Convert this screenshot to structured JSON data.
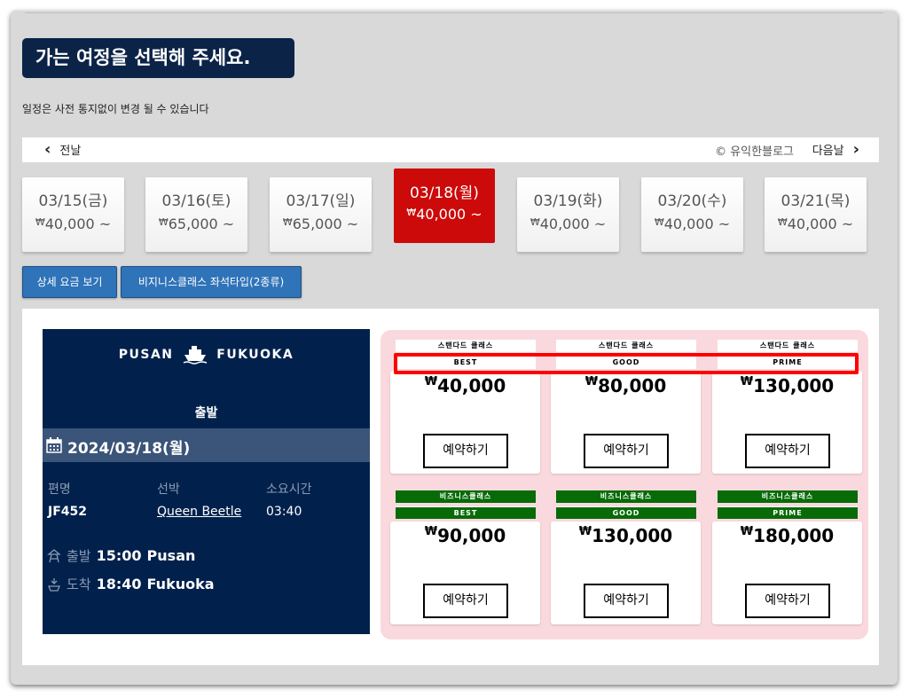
{
  "header": {
    "title": "가는 여정을 선택해 주세요.",
    "subtitle": "일정은 사전 통지없이 변경 될 수 있습니다"
  },
  "date_nav": {
    "prev_label": "전날",
    "next_label": "다음날",
    "watermark": "© 유익한블로그"
  },
  "currency_symbol": "₩",
  "days": [
    {
      "date": "03/15(금)",
      "price": "40,000 ~",
      "active": false
    },
    {
      "date": "03/16(토)",
      "price": "65,000 ~",
      "active": false
    },
    {
      "date": "03/17(일)",
      "price": "65,000 ~",
      "active": false
    },
    {
      "date": "03/18(월)",
      "price": "40,000 ~",
      "active": true
    },
    {
      "date": "03/19(화)",
      "price": "40,000 ~",
      "active": false
    },
    {
      "date": "03/20(수)",
      "price": "40,000 ~",
      "active": false
    },
    {
      "date": "03/21(목)",
      "price": "40,000 ~",
      "active": false
    }
  ],
  "buttons": {
    "fare_detail": "상세 요금 보기",
    "business_seats": "비지니스클래스 좌석타입(2종류)"
  },
  "route": {
    "from": "PUSAN",
    "to": "FUKUOKA",
    "departure_heading": "출발",
    "date": "2024/03/18(월)",
    "headers": {
      "flight": "편명",
      "ship": "선박",
      "duration": "소요시간"
    },
    "flight_no": "JF452",
    "ship_name": "Queen Beetle",
    "duration": "03:40",
    "depart": {
      "label": "출발",
      "time": "15:00",
      "place": "Pusan"
    },
    "arrive": {
      "label": "도착",
      "time": "18:40",
      "place": "Fukuoka"
    }
  },
  "fares": {
    "standard": {
      "class_label": "스탠다드 클래스",
      "items": [
        {
          "grade": "BEST",
          "price": "40,000",
          "button": "예약하기"
        },
        {
          "grade": "GOOD",
          "price": "80,000",
          "button": "예약하기"
        },
        {
          "grade": "PRIME",
          "price": "130,000",
          "button": "예약하기"
        }
      ]
    },
    "business": {
      "class_label": "비즈니스클래스",
      "items": [
        {
          "grade": "BEST",
          "price": "90,000",
          "button": "예약하기"
        },
        {
          "grade": "GOOD",
          "price": "130,000",
          "button": "예약하기"
        },
        {
          "grade": "PRIME",
          "price": "180,000",
          "button": "예약하기"
        }
      ]
    }
  },
  "colors": {
    "navy": "#0c2348",
    "active_red": "#cc0a0a",
    "business_green": "#076b07",
    "highlight_red": "#ff0000",
    "fare_bg": "#f9d9dd"
  }
}
